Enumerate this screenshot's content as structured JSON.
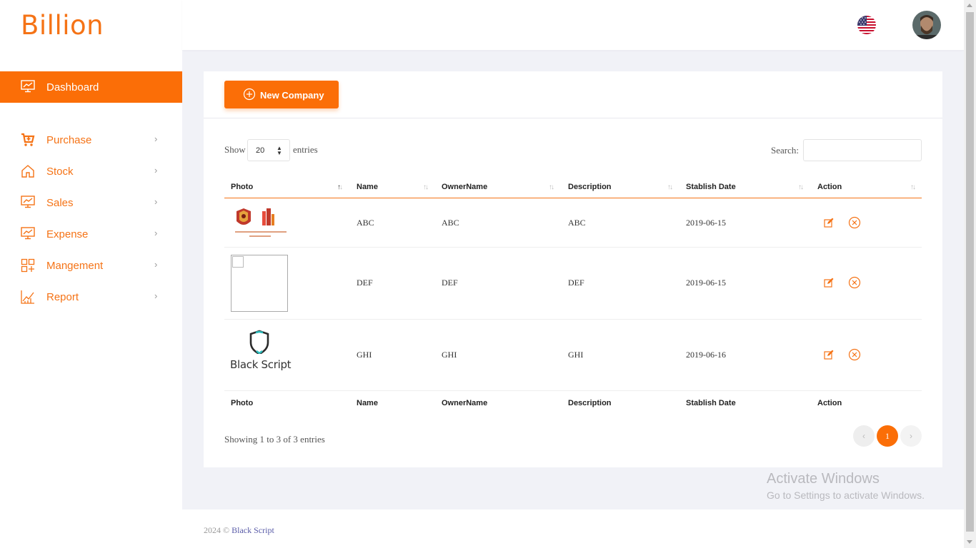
{
  "brand": {
    "name": "Billion"
  },
  "sidebar": {
    "active": {
      "label": "Dashboard",
      "icon": "chart-monitor-icon"
    },
    "items": [
      {
        "label": "Purchase",
        "icon": "cart-icon"
      },
      {
        "label": "Stock",
        "icon": "home-icon"
      },
      {
        "label": "Sales",
        "icon": "chart-monitor-icon"
      },
      {
        "label": "Expense",
        "icon": "chart-monitor-icon"
      },
      {
        "label": "Mangement",
        "icon": "grid-icon"
      },
      {
        "label": "Report",
        "icon": "line-chart-icon"
      }
    ],
    "chevron": "›"
  },
  "topbar": {
    "flag": "us-flag-icon",
    "avatar": "user-avatar"
  },
  "toolbar": {
    "new_company_label": "New Company"
  },
  "table_controls": {
    "show_label": "Show",
    "page_size": "20",
    "entries_label": "entries",
    "search_label": "Search:",
    "search_value": ""
  },
  "table": {
    "columns": [
      "Photo",
      "Name",
      "OwnerName",
      "Description",
      "Stablish Date",
      "Action"
    ],
    "rows": [
      {
        "photo": "logo-image",
        "name": "ABC",
        "owner": "ABC",
        "description": "ABC",
        "date": "2019-06-15"
      },
      {
        "photo": "broken-image",
        "name": "DEF",
        "owner": "DEF",
        "description": "DEF",
        "date": "2019-06-15"
      },
      {
        "photo": "black-script-logo",
        "photo_text": "Black Script",
        "name": "GHI",
        "owner": "GHI",
        "description": "GHI",
        "date": "2019-06-16"
      }
    ]
  },
  "pagination": {
    "info": "Showing 1 to 3 of 3 entries",
    "current": "1",
    "prev": "‹",
    "next": "›"
  },
  "watermark": {
    "line1": "Activate Windows",
    "line2": "Go to Settings to activate Windows."
  },
  "footer": {
    "year": "2024 ©",
    "link": "Black Script"
  },
  "colors": {
    "accent": "#fb6e07",
    "brand": "#f57316"
  }
}
